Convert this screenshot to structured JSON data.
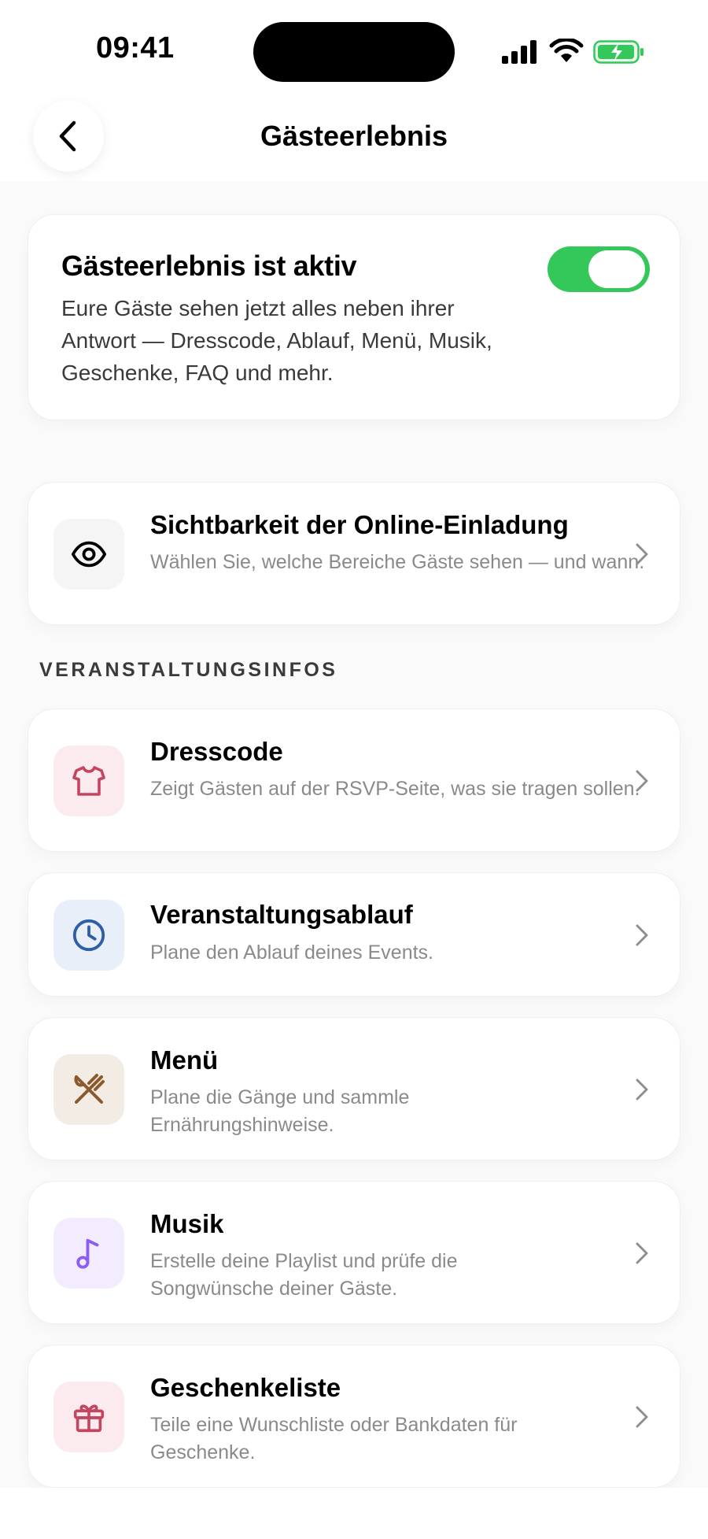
{
  "status_bar": {
    "time": "09:41"
  },
  "nav": {
    "title": "Gästeerlebnis",
    "back_icon": "chevron-left-icon"
  },
  "hero": {
    "title": "Gästeerlebnis ist aktiv",
    "description": "Eure Gäste sehen jetzt alles neben ihrer Antwort — Dresscode, Ablauf, Menü, Musik, Geschenke, FAQ und mehr.",
    "toggle_on": true,
    "toggle_color": "#34c759"
  },
  "visibility": {
    "title": "Sichtbarkeit der Online-Einladung",
    "subtitle": "Wählen Sie, welche Bereiche Gäste sehen — und wann.",
    "icon": "eye-icon"
  },
  "section_header": "VERANSTALTUNGSINFOS",
  "items": [
    {
      "title": "Dresscode",
      "subtitle": "Zeigt Gästen auf der RSVP-Seite, was sie tragen sollen.",
      "icon": "tshirt-icon",
      "icon_color": "#c4455f",
      "tile_color": "#fbeaee"
    },
    {
      "title": "Veranstaltungsablauf",
      "subtitle": "Plane den Ablauf deines Events.",
      "icon": "clock-icon",
      "icon_color": "#2f5ea8",
      "tile_color": "#e9eff8"
    },
    {
      "title": "Menü",
      "subtitle": "Plane die Gänge und sammle Ernährungshinweise.",
      "icon": "utensils-icon",
      "icon_color": "#8a5a2e",
      "tile_color": "#f3ece4"
    },
    {
      "title": "Musik",
      "subtitle": "Erstelle deine Playlist und prüfe die Songwünsche deiner Gäste.",
      "icon": "music-note-icon",
      "icon_color": "#8b5cf6",
      "tile_color": "#f2ecfe"
    },
    {
      "title": "Geschenkeliste",
      "subtitle": "Teile eine Wunschliste oder Bankdaten für Geschenke.",
      "icon": "gift-icon",
      "icon_color": "#c4455f",
      "tile_color": "#fbeaee"
    }
  ]
}
